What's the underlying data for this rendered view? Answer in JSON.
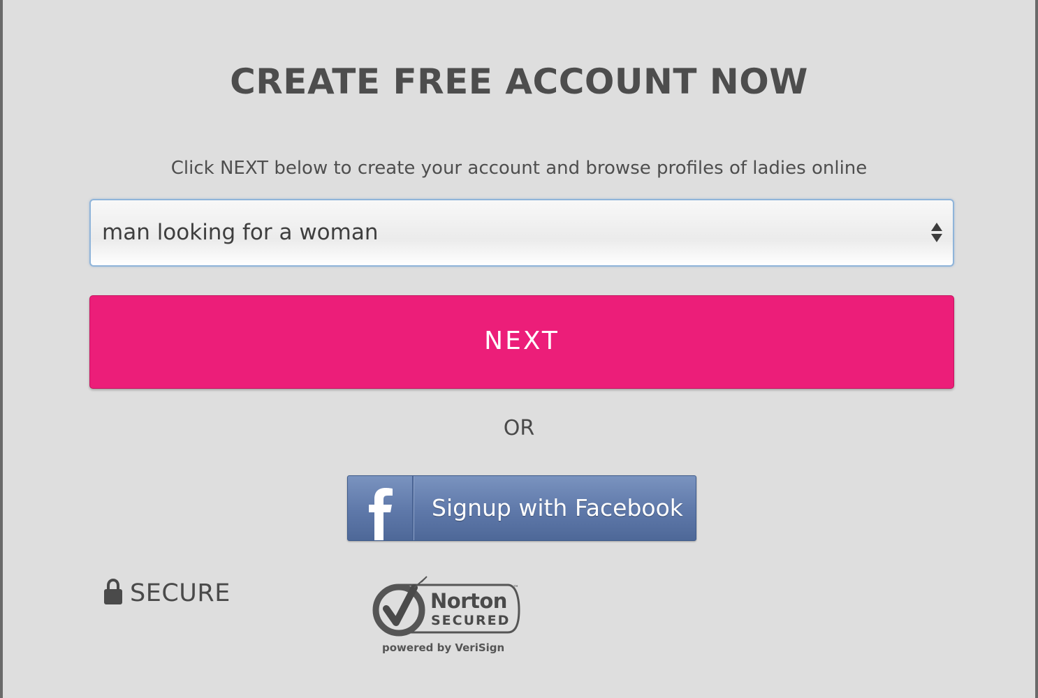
{
  "header": {
    "title": "CREATE FREE ACCOUNT NOW",
    "subtitle": "Click NEXT below to create your account and browse profiles of ladies online"
  },
  "form": {
    "seeking_select": {
      "value": "man looking for a woman"
    },
    "next_label": "NEXT",
    "or_label": "OR",
    "facebook_label": "Signup with Facebook"
  },
  "footer": {
    "secure_label": "SECURE",
    "norton_badge": {
      "brand": "Norton",
      "secured": "SECURED",
      "powered_by": "powered by VeriSign",
      "tm": "™"
    }
  },
  "colors": {
    "background": "#dedede",
    "next_button": "#ec1e79",
    "facebook_button": "#5e78a9",
    "text": "#4d4d4d"
  },
  "icons": [
    "lock-icon",
    "facebook-f-icon",
    "select-arrows-icon",
    "norton-checkmark-icon"
  ]
}
